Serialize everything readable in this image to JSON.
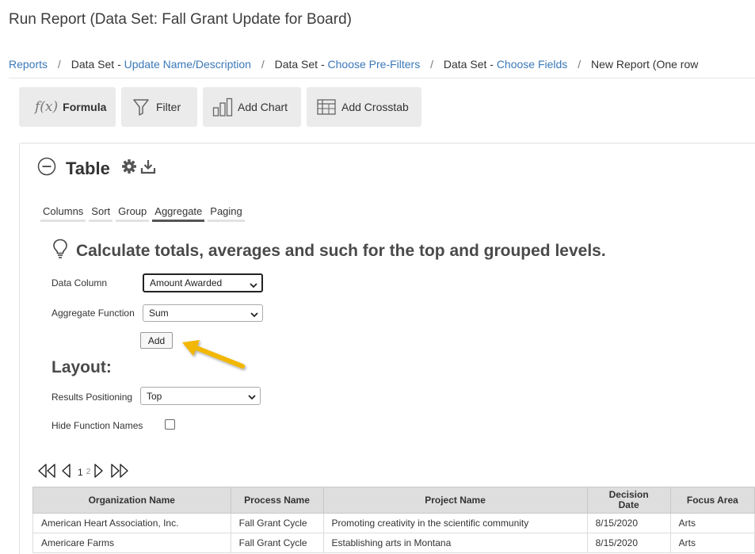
{
  "page": {
    "title": "Run Report (Data Set: Fall Grant Update for Board)"
  },
  "breadcrumb": {
    "reports": "Reports",
    "step1_prefix": "Data Set - ",
    "step1_link": "Update Name/Description",
    "step2_prefix": "Data Set - ",
    "step2_link": "Choose Pre-Filters",
    "step3_prefix": "Data Set - ",
    "step3_link": "Choose Fields",
    "current": "New Report (One row",
    "separator": "/"
  },
  "toolbar": {
    "formula_label": "Formula",
    "filter_label": "Filter",
    "add_chart_label": "Add Chart",
    "add_crosstab_label": "Add Crosstab"
  },
  "table_panel": {
    "title": "Table",
    "tabs": [
      {
        "label": "Columns",
        "active": false
      },
      {
        "label": "Sort",
        "active": false
      },
      {
        "label": "Group",
        "active": false
      },
      {
        "label": "Aggregate",
        "active": true
      },
      {
        "label": "Paging",
        "active": false
      }
    ],
    "hint": "Calculate totals, averages and such for the top and grouped levels."
  },
  "aggregate_form": {
    "data_column_label": "Data Column",
    "data_column_value": "Amount Awarded",
    "aggregate_function_label": "Aggregate Function",
    "aggregate_function_value": "Sum",
    "add_button": "Add"
  },
  "layout": {
    "title": "Layout:",
    "results_positioning_label": "Results Positioning",
    "results_positioning_value": "Top",
    "hide_function_names_label": "Hide Function Names",
    "hide_function_names_checked": false
  },
  "pager": {
    "current_page": "1",
    "next_page": "2"
  },
  "results_table": {
    "columns": [
      "Organization Name",
      "Process Name",
      "Project Name",
      "Decision Date",
      "Focus Area"
    ],
    "rows": [
      [
        "American Heart Association, Inc.",
        "Fall Grant Cycle",
        "Promoting creativity in the scientific community",
        "8/15/2020",
        "Arts"
      ],
      [
        "Americare Farms",
        "Fall Grant Cycle",
        "Establishing arts in Montana",
        "8/15/2020",
        "Arts"
      ]
    ]
  },
  "colors": {
    "link": "#3b78b8",
    "button_bg": "#ebebeb",
    "annotation_arrow": "#f2b705",
    "header_bg": "#dedede"
  },
  "icons": [
    "function-icon",
    "filter-icon",
    "bar-chart-icon",
    "crosstab-icon",
    "collapse-minus-icon",
    "gear-icon",
    "download-icon",
    "lightbulb-icon",
    "chevron-down-icon",
    "first-page-icon",
    "previous-page-icon",
    "next-page-icon",
    "last-page-icon",
    "arrow-annotation-icon"
  ]
}
